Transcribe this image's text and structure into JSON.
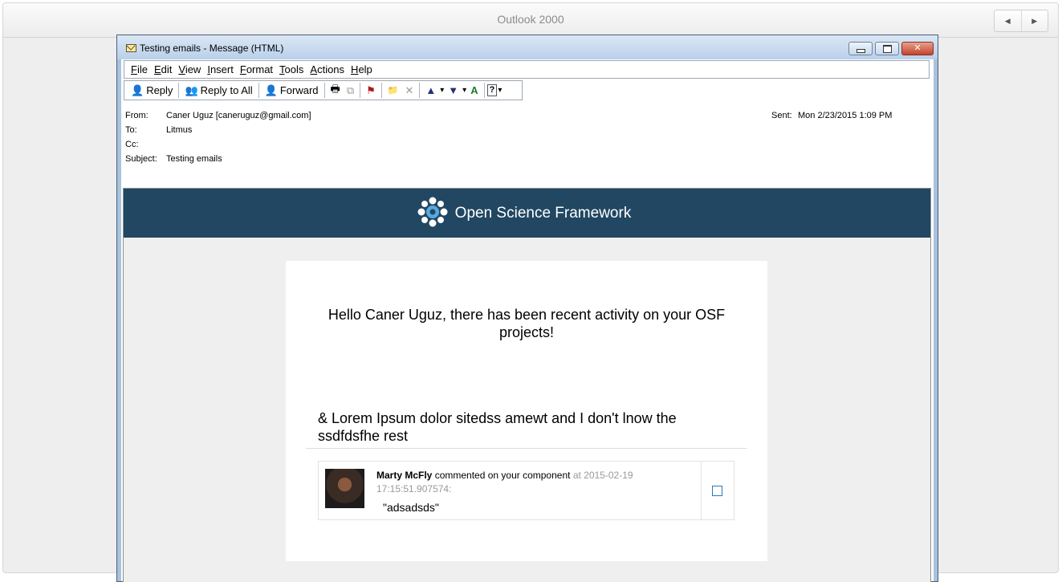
{
  "frame": {
    "title": "Outlook 2000",
    "nav": [
      "◀",
      "▶"
    ]
  },
  "window": {
    "title": "Testing emails - Message (HTML)",
    "controls": {
      "close": "✕"
    }
  },
  "menu": [
    "File",
    "Edit",
    "View",
    "Insert",
    "Format",
    "Tools",
    "Actions",
    "Help"
  ],
  "toolbar": {
    "reply": "Reply",
    "reply_all": "Reply to All",
    "forward": "Forward",
    "icons": {
      "print": "🖶",
      "copy": "⧉",
      "flag": "⚑",
      "move": "📁",
      "delete": "✕",
      "up": "▲",
      "down": "▼",
      "dropdown": "▾",
      "address_book": "A",
      "help": "?"
    }
  },
  "headers": {
    "from_label": "From:",
    "from": "Caner Uguz [caneruguz@gmail.com]",
    "to_label": "To:",
    "to": "Litmus",
    "cc_label": "Cc:",
    "cc": "",
    "subject_label": "Subject:",
    "subject": "Testing emails",
    "sent_label": "Sent:",
    "sent": "Mon 2/23/2015 1:09 PM"
  },
  "email": {
    "brand": "Open Science Framework",
    "greeting": "Hello Caner Uguz, there has been recent activity on your OSF projects!",
    "section_title": "& Lorem Ipsum dolor sitedss amewt and I don't lnow the ssdfdsfhe rest",
    "comment": {
      "user": "Marty McFly",
      "action": "commented on your component",
      "meta": "at 2015-02-19 17:15:51.907574:",
      "text": "\"adsadsds\""
    }
  },
  "colors": {
    "banner": "#214762",
    "checkbox": "#2a7ab8"
  }
}
